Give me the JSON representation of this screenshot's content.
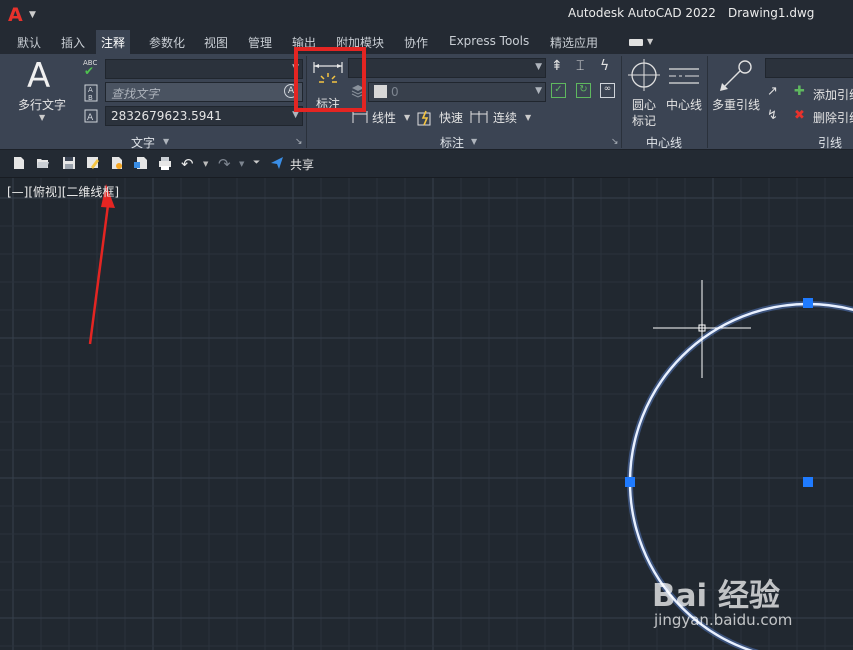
{
  "titlebar": {
    "app_title": "Autodesk AutoCAD 2022",
    "document_title": "Drawing1.dwg",
    "logo_letter": "A"
  },
  "tabs": [
    {
      "label": "默认"
    },
    {
      "label": "插入"
    },
    {
      "label": "注释",
      "active": true
    },
    {
      "label": "参数化"
    },
    {
      "label": "视图"
    },
    {
      "label": "管理"
    },
    {
      "label": "输出"
    },
    {
      "label": "附加模块"
    },
    {
      "label": "协作"
    },
    {
      "label": "Express Tools"
    },
    {
      "label": "精选应用"
    }
  ],
  "ribbon": {
    "text_panel": {
      "mtext_label": "多行文字",
      "mtext_glyph": "A",
      "find_placeholder": "查找文字",
      "text_height_value": "2832679623.5941",
      "panel_label": "文字",
      "abc_glyph": "ABC"
    },
    "dim_panel": {
      "dimension_label": "标注",
      "layer_value": "0",
      "linear_label": "线性",
      "quick_label": "快速",
      "continue_label": "连续",
      "panel_label": "标注"
    },
    "centerline_panel": {
      "center_mark_label_1": "圆心",
      "center_mark_label_2": "标记",
      "centerline_label": "中心线",
      "panel_label": "中心线"
    },
    "leader_panel": {
      "multileader_label": "多重引线",
      "add_leader_label": "添加引线",
      "remove_leader_label": "删除引线",
      "panel_label": "引线"
    }
  },
  "quick_access": {
    "share_label": "共享"
  },
  "viewport": {
    "label": "[—][俯视][二维线框]"
  },
  "watermark": {
    "main": "Bai 经验",
    "url": "jingyan.baidu.com"
  },
  "colors": {
    "accent_red": "#e42522",
    "circle": "#cfe0ff",
    "grip": "#1f7bff",
    "canvas": "#212830"
  }
}
